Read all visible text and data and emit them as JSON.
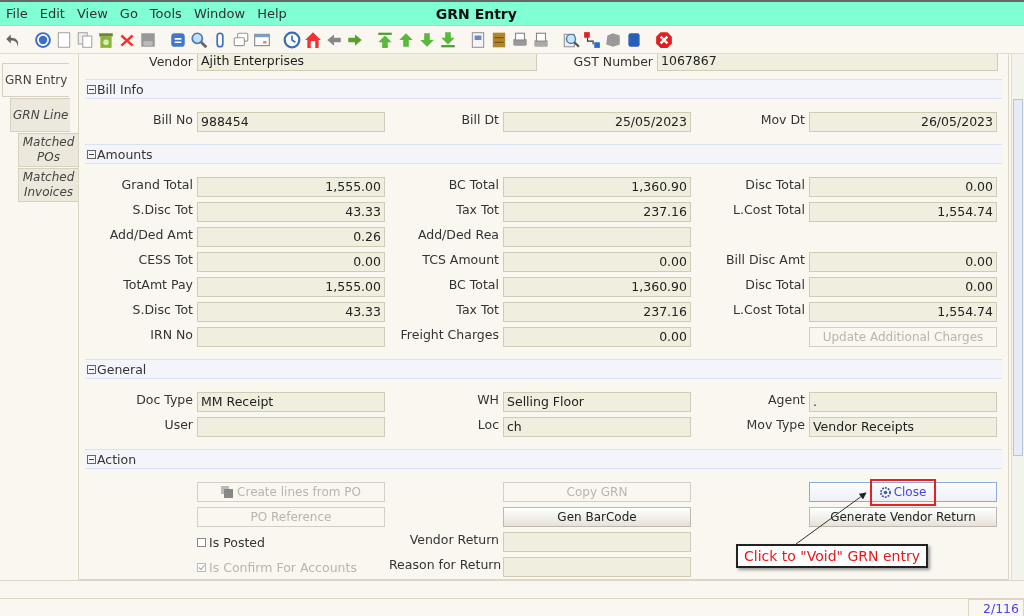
{
  "menu_bar": {
    "items": [
      "File",
      "Edit",
      "View",
      "Go",
      "Tools",
      "Window",
      "Help"
    ],
    "title": "GRN Entry"
  },
  "tabs": [
    {
      "label": "GRN Entry",
      "selected": true,
      "children": [
        {
          "label": "GRN Line",
          "selected": false,
          "children": [
            {
              "label": "Matched POs",
              "selected": false
            },
            {
              "label": "Matched Invoices",
              "selected": false
            }
          ]
        }
      ]
    }
  ],
  "vendor_row": {
    "vendor_label": "Vendor",
    "vendor_value": "Ajith Enterprises",
    "gst_label": "GST Number",
    "gst_value": "1067867"
  },
  "sections": [
    {
      "title": "Bill Info",
      "expanded": true,
      "rows": [
        [
          {
            "kind": "text-field",
            "label": "Bill No",
            "value": "988454"
          },
          {
            "kind": "amount-field",
            "label": "Bill Dt",
            "value": "25/05/2023"
          },
          {
            "kind": "amount-field",
            "label": "Mov Dt",
            "value": "26/05/2023"
          }
        ]
      ]
    },
    {
      "title": "Amounts",
      "expanded": true,
      "rows": [
        [
          {
            "kind": "amount-field",
            "label": "Grand Total",
            "value": "1,555.00"
          },
          {
            "kind": "amount-field",
            "label": "BC Total",
            "value": "1,360.90"
          },
          {
            "kind": "amount-field",
            "label": "Disc Total",
            "value": "0.00"
          }
        ],
        [
          {
            "kind": "amount-field",
            "label": "S.Disc Tot",
            "value": "43.33"
          },
          {
            "kind": "amount-field",
            "label": "Tax Tot",
            "value": "237.16"
          },
          {
            "kind": "amount-field",
            "label": "L.Cost Total",
            "value": "1,554.74"
          }
        ],
        [
          {
            "kind": "amount-field",
            "label": "Add/Ded Amt",
            "value": "0.26"
          },
          {
            "kind": "text-field",
            "label": "Add/Ded Rea"
          },
          {
            "kind": "blank"
          }
        ],
        [
          {
            "kind": "amount-field",
            "label": "CESS Tot",
            "value": "0.00"
          },
          {
            "kind": "amount-field",
            "label": "TCS Amount",
            "value": "0.00"
          },
          {
            "kind": "amount-field",
            "label": "Bill Disc Amt",
            "value": "0.00"
          }
        ],
        [
          {
            "kind": "amount-field",
            "label": "TotAmt Pay",
            "value": "1,555.00"
          },
          {
            "kind": "amount-field",
            "label": "BC Total",
            "value": "1,360.90"
          },
          {
            "kind": "amount-field",
            "label": "Disc Total",
            "value": "0.00"
          }
        ],
        [
          {
            "kind": "amount-field",
            "label": "S.Disc Tot",
            "value": "43.33"
          },
          {
            "kind": "amount-field",
            "label": "Tax Tot",
            "value": "237.16"
          },
          {
            "kind": "amount-field",
            "label": "L.Cost Total",
            "value": "1,554.74"
          }
        ],
        [
          {
            "kind": "text-field",
            "label": "IRN No"
          },
          {
            "kind": "amount-field",
            "label": "Freight Charges",
            "value": "0.00"
          },
          {
            "kind": "button",
            "label": "Update Additional Charges",
            "disabled": true,
            "focused": false
          }
        ]
      ]
    },
    {
      "title": "General",
      "expanded": true,
      "rows": [
        [
          {
            "kind": "text-field",
            "label": "Doc Type",
            "value": "MM Receipt"
          },
          {
            "kind": "text-field",
            "label": "WH",
            "value": "Selling Floor"
          },
          {
            "kind": "text-field",
            "label": "Agent",
            "value": "."
          }
        ],
        [
          {
            "kind": "text-field",
            "label": "User"
          },
          {
            "kind": "text-field",
            "label": "Loc",
            "value": "ch"
          },
          {
            "kind": "text-field",
            "label": "Mov Type",
            "value": "Vendor Receipts"
          }
        ]
      ]
    },
    {
      "title": "Action",
      "expanded": true,
      "rows": [
        [
          {
            "kind": "copy-button",
            "label": "Create lines from PO",
            "disabled": true,
            "focused": false
          },
          {
            "kind": "button",
            "label": "Copy GRN",
            "disabled": true,
            "focused": false
          },
          {
            "kind": "gear-button",
            "label": "Close",
            "disabled": false,
            "focused": true
          }
        ],
        [
          {
            "kind": "button",
            "label": "PO Reference",
            "disabled": true,
            "focused": false
          },
          {
            "kind": "button",
            "label": "Gen BarCode",
            "disabled": false,
            "focused": false
          },
          {
            "kind": "button",
            "label": "Generate Vendor Return",
            "disabled": false,
            "focused": false
          }
        ],
        [
          {
            "kind": "checkbox",
            "label": "Is Posted",
            "checked": false,
            "disabled": false
          },
          {
            "kind": "text-field",
            "label": "Vendor Return"
          },
          {
            "kind": "blank"
          }
        ],
        [
          {
            "kind": "checkbox",
            "label": "Is Confirm For Accounts",
            "checked": true,
            "disabled": true
          },
          {
            "kind": "text-field",
            "label": "Reason for Return"
          },
          {
            "kind": "blank"
          }
        ]
      ]
    }
  ],
  "annotation": {
    "callout": "Click to \"Void\" GRN entry"
  },
  "status_bar": {
    "record_count": "2/116"
  }
}
